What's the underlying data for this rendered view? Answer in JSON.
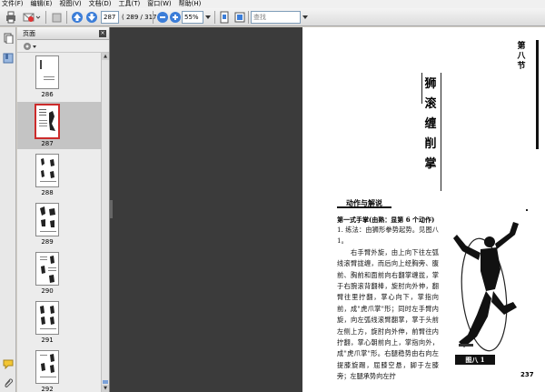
{
  "menubar": {
    "items": [
      "文件(F)",
      "编辑(E)",
      "视图(V)",
      "文档(D)",
      "工具(T)",
      "窗口(W)",
      "帮助(H)"
    ]
  },
  "toolbar": {
    "current_page": "287",
    "page_count": "( 289 / 317 )",
    "zoom": "55%",
    "search_placeholder": "查找"
  },
  "panel": {
    "title": "页面",
    "close_glyph": "×",
    "thumbnails": [
      {
        "label": "286"
      },
      {
        "label": "287"
      },
      {
        "label": "288"
      },
      {
        "label": "289"
      },
      {
        "label": "290"
      },
      {
        "label": "291"
      },
      {
        "label": "292"
      }
    ]
  },
  "document": {
    "side_title": "第八节",
    "vertical_title": "狮滚缠削掌",
    "section_heading": "动作与解说",
    "subheading": "第一式手掌(由熟：显第 6 个动作)",
    "body": "1. 练法：由狮形拳势起势。见图八 1。\n　　右手臂外旋，由上向下往左弧线滚臂拢缠，而后向上经胸旁、腹前、胸前和面前向右翻掌缠拢，掌于右腕滚背翻棒，旋肘向外伸，翻臂往里拧翻，掌心向下，掌指向前，成\"虎爪掌\"形；同时左手臂内旋，向左弧线滚臂翻掌，掌于头前左侧上方，旋肘向外伸，前臂往内拧翻，掌心朝前向上，掌指向外，成\"虎爪掌\"形。右腿稳势由右向左提膝旋踢，屈膝空悬，脚于左膝旁；左腿承势向左拧",
    "figure_caption": "图八 1",
    "page_number": "237"
  },
  "colors": {
    "selected_thumb_border": "#cc2b2b",
    "doc_background": "#3b3b3b"
  }
}
